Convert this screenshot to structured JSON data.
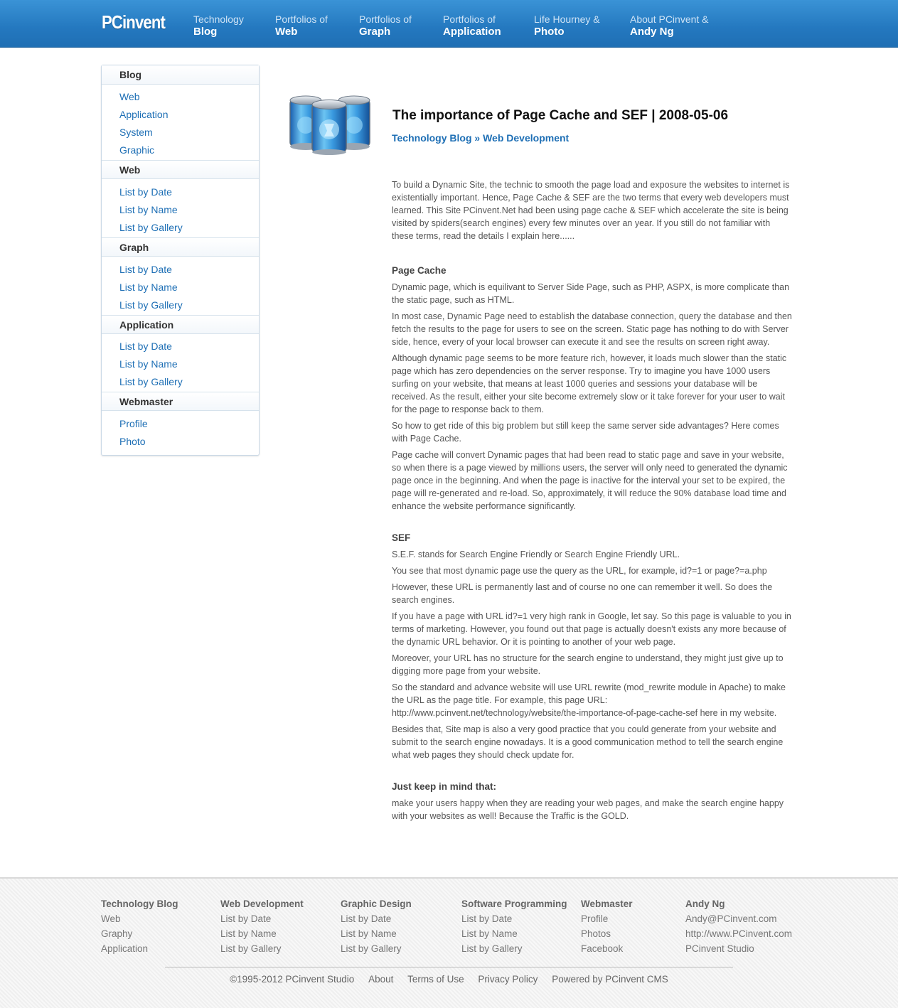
{
  "header": {
    "logo": "PCinvent",
    "nav": [
      {
        "top": "Technology",
        "bottom": "Blog"
      },
      {
        "top": "Portfolios of",
        "bottom": "Web"
      },
      {
        "top": "Portfolios of",
        "bottom": "Graph"
      },
      {
        "top": "Portfolios of",
        "bottom": "Application"
      },
      {
        "top": "Life Hourney &",
        "bottom": "Photo"
      },
      {
        "top": "About PCinvent &",
        "bottom": "Andy Ng"
      }
    ]
  },
  "sidebar": {
    "sections": [
      {
        "title": "Blog",
        "links": [
          "Web",
          "Application",
          "System",
          "Graphic"
        ]
      },
      {
        "title": "Web",
        "links": [
          "List by Date",
          "List by Name",
          "List by Gallery"
        ]
      },
      {
        "title": "Graph",
        "links": [
          "List by Date",
          "List by Name",
          "List by Gallery"
        ]
      },
      {
        "title": "Application",
        "links": [
          "List by Date",
          "List by Name",
          "List by Gallery"
        ]
      },
      {
        "title": "Webmaster",
        "links": [
          "Profile",
          "Photo"
        ]
      }
    ]
  },
  "article": {
    "title": "The importance of Page Cache and SEF | 2008-05-06",
    "breadcrumb": {
      "part1": "Technology Blog",
      "sep": " » ",
      "part2": "Web Development"
    },
    "intro": "To build a Dynamic Site, the technic to smooth the page load and exposure the websites to internet is existentially important. Hence, Page Cache & SEF are the two terms that every web developers must learned. This Site PCinvent.Net had been using page cache & SEF which accelerate the site is being visited by spiders(search engines) every few minutes over an year. If you still do not familiar with these terms, read the details I explain here......",
    "page_cache_heading": "Page Cache",
    "page_cache": [
      "Dynamic page, which is equilivant to Server Side Page, such as PHP, ASPX, is more complicate than the static page, such as HTML.",
      "In most case, Dynamic Page need to establish the database connection, query the database and then fetch the results to the page for users to see on the screen. Static page has nothing to do with Server side, hence, every of your local browser can execute it and see the results on screen right away.",
      "Although dynamic page seems to be more feature rich, however, it loads much slower than the static page which has zero dependencies on the server response. Try to imagine you have 1000 users surfing on your website, that means at least 1000 queries and sessions your database will be received. As the result, either your site become extremely slow or it take forever for your user to wait for the page to response back to them.",
      "So how to get ride of this big problem but still keep the same server side advantages? Here comes with Page Cache.",
      "Page cache will convert Dynamic pages that had been read to static page and save in your website, so when there is a page viewed by millions users, the server will only need to generated the dynamic page once in the beginning. And when the page is inactive for the interval your set to be expired, the page will re-generated and re-load. So, approximately, it will reduce the 90% database load  time and enhance the website performance significantly."
    ],
    "sef_heading": "SEF",
    "sef": [
      "S.E.F. stands for Search Engine Friendly or Search Engine Friendly URL.",
      "You see that most dynamic page use the query as the URL, for example, id?=1 or page?=a.php",
      "However, these URL is permanently last and of course no one can remember it well. So does the search engines.",
      "If you have a page with URL id?=1 very high rank in Google, let say. So this page is valuable to you in terms of marketing. However,  you found out that page is actually doesn't exists any more because of the dynamic URL behavior. Or it is pointing to another of your web page.",
      "Moreover, your URL has no structure for the search engine to understand, they might just give up to digging more page from your website.",
      "So the standard and advance website will use URL rewrite (mod_rewrite module in Apache) to make the URL as the page title. For example, this page URL: http://www.pcinvent.net/technology/website/the-importance-of-page-cache-sef here in my website.",
      "Besides that, Site map is also a very good practice that you could generate from your website and submit to the search engine nowadays. It is a good communication method to tell the search engine what web pages they should check update for."
    ],
    "keep_heading": "Just keep in mind that:",
    "keep": "make your users happy when they are reading your web pages, and make the search engine happy with your websites as well! Because the Traffic is the GOLD."
  },
  "footer": {
    "columns": [
      {
        "heading": "Technology Blog",
        "links": [
          "Web",
          "Graphy",
          "Application"
        ]
      },
      {
        "heading": "Web Development",
        "links": [
          "List by Date",
          "List by Name",
          "List by Gallery"
        ]
      },
      {
        "heading": "Graphic Design",
        "links": [
          "List by Date",
          "List by Name",
          "List by Gallery"
        ]
      },
      {
        "heading": "Software Programming",
        "links": [
          "List by Date",
          "List by Name",
          "List by Gallery"
        ]
      },
      {
        "heading": "Webmaster",
        "links": [
          "Profile",
          "Photos",
          "Facebook"
        ]
      },
      {
        "heading": "Andy Ng",
        "links": [
          "Andy@PCinvent.com",
          "http://www.PCinvent.com",
          "PCinvent Studio"
        ]
      }
    ],
    "bottom": {
      "copyright": "©1995-2012 PCinvent Studio",
      "about": "About",
      "terms": "Terms of Use",
      "privacy": "Privacy Policy",
      "powered": "Powered by PCinvent CMS"
    }
  },
  "colors": {
    "header_blue": "#2478bf",
    "link_blue": "#1e6fb5"
  },
  "icons": {
    "article_icon": "cache-cans-icon"
  }
}
